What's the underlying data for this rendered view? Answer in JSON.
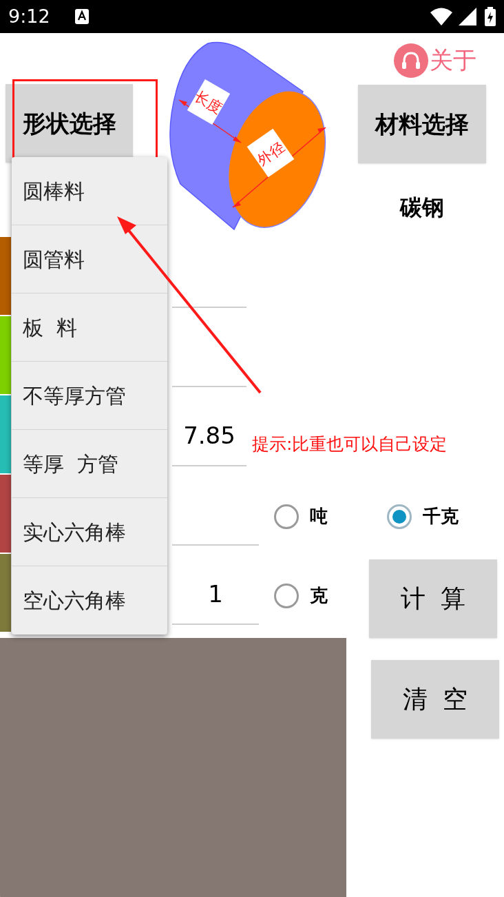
{
  "status_bar": {
    "time": "9:12"
  },
  "about": {
    "label": "关于"
  },
  "shape_button": {
    "label": "形状选择"
  },
  "diagram": {
    "labels": [
      "长度",
      "外径"
    ]
  },
  "material_button": {
    "label": "材料选择"
  },
  "material": "碳钢",
  "rows": [
    {
      "color": "#b35c00"
    },
    {
      "color": "#7ed000"
    },
    {
      "color": "#26bdb5",
      "value": "7.85"
    },
    {
      "color": "#b24444"
    },
    {
      "color": "#7e7a3c",
      "value": "1"
    }
  ],
  "hint": "提示:比重也可以自己设定",
  "units": [
    {
      "label": "吨",
      "selected": false
    },
    {
      "label": "千克",
      "selected": true
    },
    {
      "label": "克",
      "selected": false
    }
  ],
  "calc_button": {
    "label": "计  算"
  },
  "clear_button": {
    "label": "清  空"
  },
  "shape_menu": {
    "items": [
      {
        "label": "圆棒料"
      },
      {
        "label": "圆管料"
      },
      {
        "label": "板  料"
      },
      {
        "label": "不等厚方管"
      },
      {
        "label": "等厚  方管"
      },
      {
        "label": "实心六角棒"
      },
      {
        "label": "空心六角棒"
      }
    ]
  }
}
